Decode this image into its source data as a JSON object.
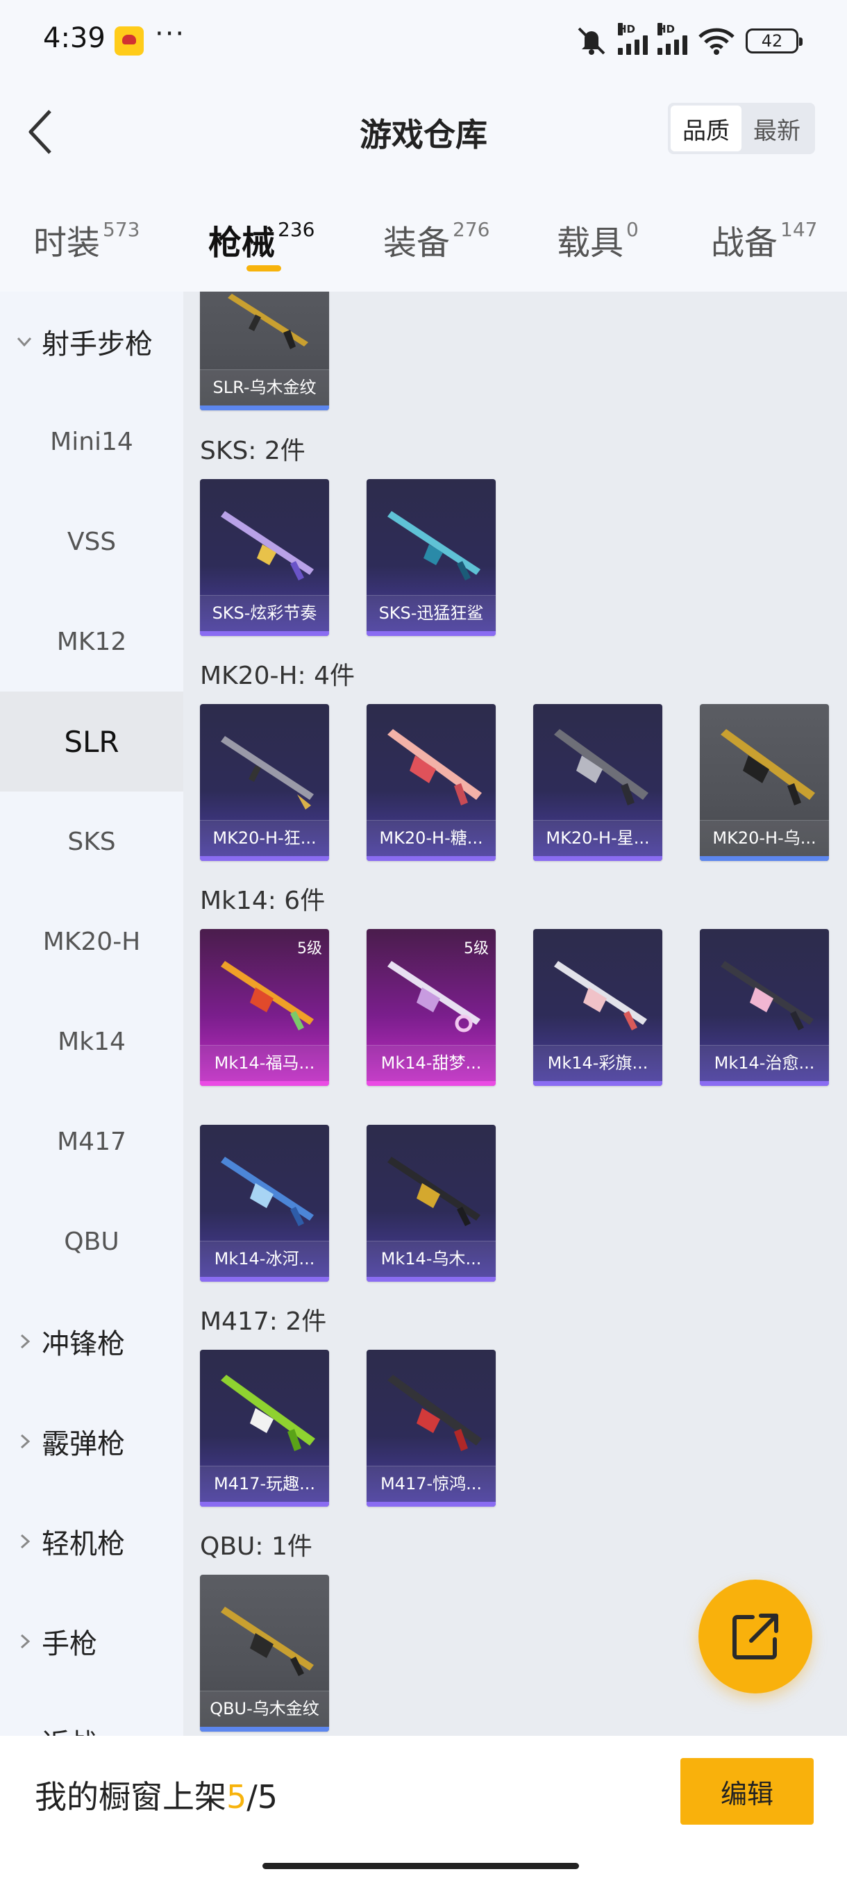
{
  "status_bar": {
    "time": "4:39",
    "dots": "···",
    "signal_1_label": "HD",
    "signal_2_label": "HD",
    "battery": "42"
  },
  "header": {
    "title": "游戏仓库",
    "sort_options": [
      "品质",
      "最新"
    ],
    "active_sort": "品质"
  },
  "tabs": [
    {
      "label": "时装",
      "count": "573"
    },
    {
      "label": "枪械",
      "count": "236"
    },
    {
      "label": "装备",
      "count": "276"
    },
    {
      "label": "载具",
      "count": "0"
    },
    {
      "label": "战备",
      "count": "147"
    }
  ],
  "active_tab": "枪械",
  "sidebar": {
    "group_expanded": "射手步枪",
    "sub_items": [
      "Mini14",
      "VSS",
      "MK12",
      "SLR",
      "SKS",
      "MK20-H",
      "Mk14",
      "M417",
      "QBU"
    ],
    "active_item": "SLR",
    "groups": [
      "冲锋枪",
      "霰弹枪",
      "轻机枪",
      "手枪",
      "近战"
    ]
  },
  "sections": [
    {
      "title": null,
      "items": [
        {
          "label": "SLR-乌木金纹",
          "rarity": "gray",
          "level": null
        }
      ]
    },
    {
      "title": "SKS: 2件",
      "items": [
        {
          "label": "SKS-炫彩节奏",
          "rarity": "purple",
          "level": null
        },
        {
          "label": "SKS-迅猛狂鲨",
          "rarity": "purple",
          "level": null
        }
      ]
    },
    {
      "title": "MK20-H: 4件",
      "items": [
        {
          "label": "MK20-H-狂...",
          "rarity": "purple",
          "level": null
        },
        {
          "label": "MK20-H-糖...",
          "rarity": "purple",
          "level": null
        },
        {
          "label": "MK20-H-星...",
          "rarity": "purple",
          "level": null
        },
        {
          "label": "MK20-H-乌...",
          "rarity": "gray",
          "level": null
        }
      ]
    },
    {
      "title": "Mk14: 6件",
      "items": [
        {
          "label": "Mk14-福马...",
          "rarity": "pink",
          "level": "5级"
        },
        {
          "label": "Mk14-甜梦...",
          "rarity": "pink",
          "level": "5级"
        },
        {
          "label": "Mk14-彩旗...",
          "rarity": "purple",
          "level": null
        },
        {
          "label": "Mk14-治愈...",
          "rarity": "purple",
          "level": null
        },
        {
          "label": "Mk14-冰河...",
          "rarity": "purple",
          "level": null
        },
        {
          "label": "Mk14-乌木...",
          "rarity": "purple",
          "level": null
        }
      ]
    },
    {
      "title": "M417: 2件",
      "items": [
        {
          "label": "M417-玩趣...",
          "rarity": "purple",
          "level": null
        },
        {
          "label": "M417-惊鸿...",
          "rarity": "purple",
          "level": null
        }
      ]
    },
    {
      "title": "QBU: 1件",
      "items": [
        {
          "label": "QBU-乌木金纹",
          "rarity": "gray",
          "level": null
        }
      ]
    }
  ],
  "bottom_bar": {
    "label": "我的橱窗上架",
    "current": "5",
    "separator": "/",
    "total": "5",
    "edit_label": "编辑"
  },
  "colors": {
    "accent": "#f9b10c",
    "purple_card": "#2e2c58",
    "gray_card": "#515359",
    "pink_card": "#c42fc6"
  },
  "icons": {
    "back": "back-arrow-icon",
    "fab": "share-external-icon",
    "chevron_down": "chevron-down-icon",
    "chevron_right": "chevron-right-icon"
  }
}
